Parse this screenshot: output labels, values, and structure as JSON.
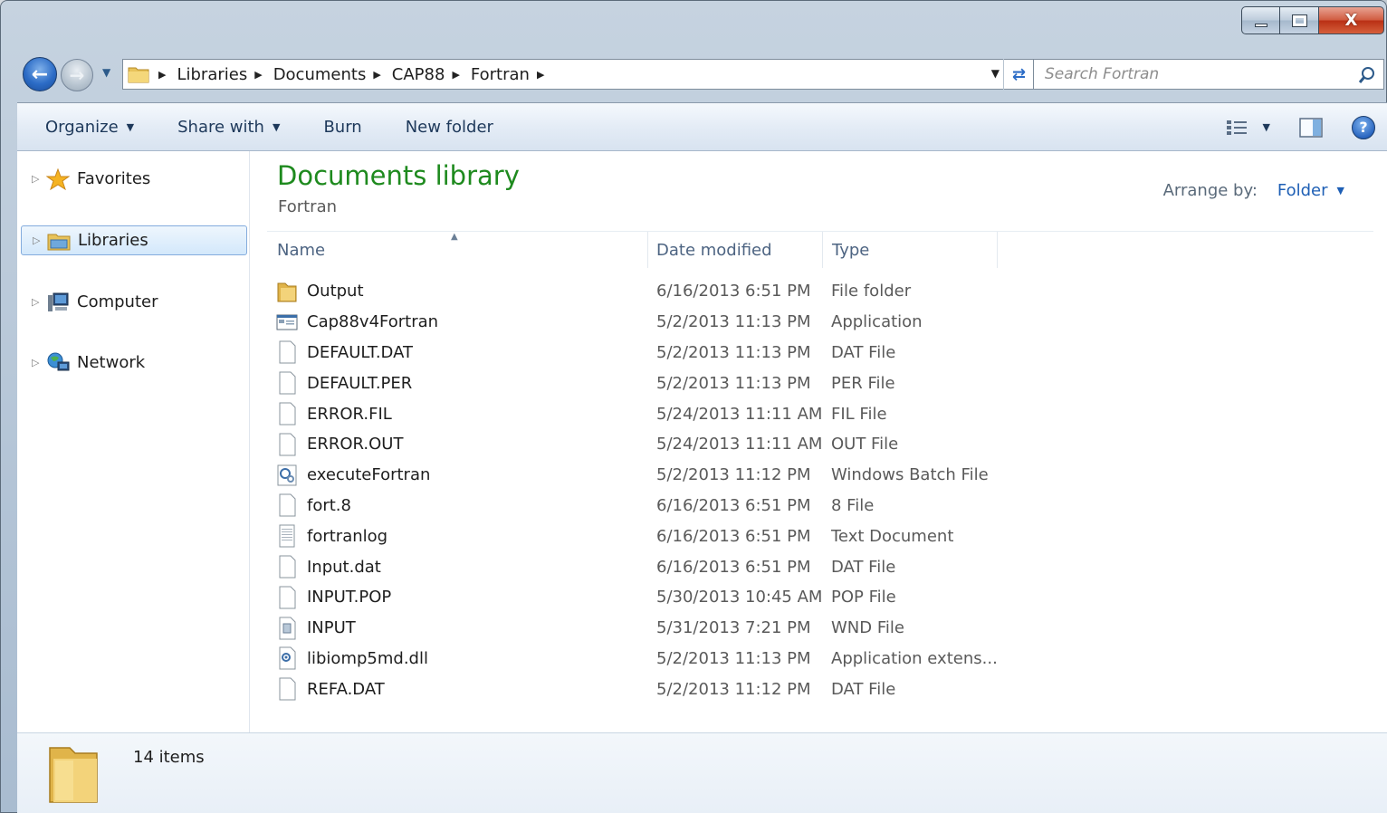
{
  "window": {
    "caption_buttons": {
      "minimize": "minimize",
      "maximize": "maximize",
      "close": "X"
    }
  },
  "address_bar": {
    "breadcrumbs": [
      "Libraries",
      "Documents",
      "CAP88",
      "Fortran"
    ]
  },
  "search": {
    "placeholder": "Search Fortran"
  },
  "toolbar": {
    "organize": "Organize",
    "share_with": "Share with",
    "burn": "Burn",
    "new_folder": "New folder"
  },
  "nav_pane": {
    "items": [
      {
        "label": "Favorites",
        "icon": "star-icon"
      },
      {
        "label": "Libraries",
        "icon": "libraries-icon",
        "selected": true
      },
      {
        "label": "Computer",
        "icon": "computer-icon"
      },
      {
        "label": "Network",
        "icon": "network-icon"
      }
    ]
  },
  "library": {
    "title": "Documents library",
    "subtitle": "Fortran",
    "arrange_label": "Arrange by:",
    "arrange_value": "Folder"
  },
  "columns": {
    "name": "Name",
    "date": "Date modified",
    "type": "Type"
  },
  "files": [
    {
      "name": "Output",
      "date": "6/16/2013 6:51 PM",
      "type": "File folder",
      "icon": "folder-icon"
    },
    {
      "name": "Cap88v4Fortran",
      "date": "5/2/2013 11:13 PM",
      "type": "Application",
      "icon": "application-icon"
    },
    {
      "name": "DEFAULT.DAT",
      "date": "5/2/2013 11:13 PM",
      "type": "DAT File",
      "icon": "file-icon"
    },
    {
      "name": "DEFAULT.PER",
      "date": "5/2/2013 11:13 PM",
      "type": "PER File",
      "icon": "file-icon"
    },
    {
      "name": "ERROR.FIL",
      "date": "5/24/2013 11:11 AM",
      "type": "FIL File",
      "icon": "file-icon"
    },
    {
      "name": "ERROR.OUT",
      "date": "5/24/2013 11:11 AM",
      "type": "OUT File",
      "icon": "file-icon"
    },
    {
      "name": "executeFortran",
      "date": "5/2/2013 11:12 PM",
      "type": "Windows Batch File",
      "icon": "batch-file-icon"
    },
    {
      "name": "fort.8",
      "date": "6/16/2013 6:51 PM",
      "type": "8 File",
      "icon": "file-icon"
    },
    {
      "name": "fortranlog",
      "date": "6/16/2013 6:51 PM",
      "type": "Text Document",
      "icon": "text-document-icon"
    },
    {
      "name": "Input.dat",
      "date": "6/16/2013 6:51 PM",
      "type": "DAT File",
      "icon": "file-icon"
    },
    {
      "name": "INPUT.POP",
      "date": "5/30/2013 10:45 AM",
      "type": "POP File",
      "icon": "file-icon"
    },
    {
      "name": "INPUT",
      "date": "5/31/2013 7:21 PM",
      "type": "WND File",
      "icon": "wnd-file-icon"
    },
    {
      "name": "libiomp5md.dll",
      "date": "5/2/2013 11:13 PM",
      "type": "Application extens...",
      "icon": "dll-file-icon"
    },
    {
      "name": "REFA.DAT",
      "date": "5/2/2013 11:12 PM",
      "type": "DAT File",
      "icon": "file-icon"
    }
  ],
  "details": {
    "count": "14 items"
  },
  "colors": {
    "accent": "#1e8a1e",
    "link": "#1e5fb5",
    "selection": "#d3e8fb"
  }
}
